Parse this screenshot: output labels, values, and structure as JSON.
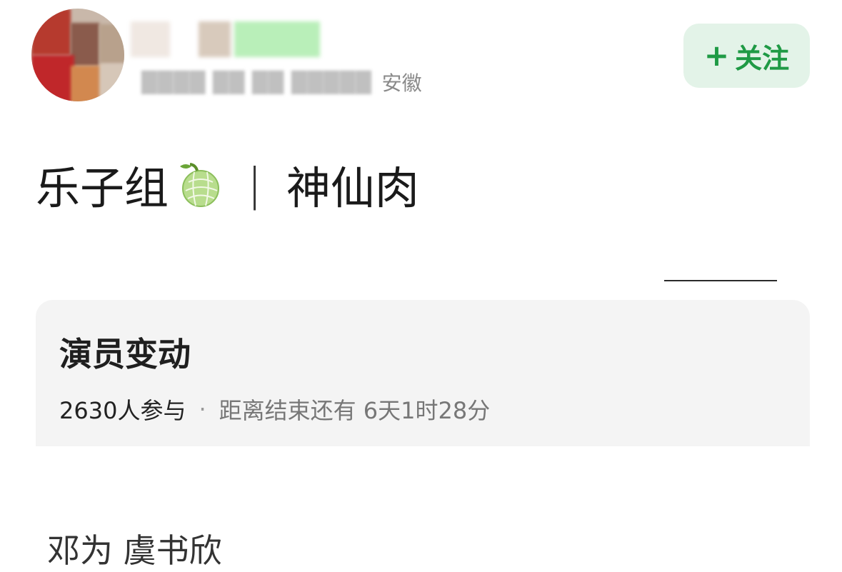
{
  "header": {
    "location": "安徽",
    "follow_label": "关注",
    "follow_icon": "plus-icon"
  },
  "post": {
    "title_left": "乐子组",
    "emoji": "melon-icon",
    "separator": "|",
    "title_right": "神仙肉"
  },
  "poll": {
    "title": "演员变动",
    "participants": "2630人参与",
    "dot": "·",
    "countdown": "距离结束还有 6天1时28分"
  },
  "names": "邓为 虞书欣",
  "colors": {
    "follow_text": "#1f9a45",
    "follow_bg": "#e3f3e8",
    "poll_bg": "#f4f4f4"
  }
}
